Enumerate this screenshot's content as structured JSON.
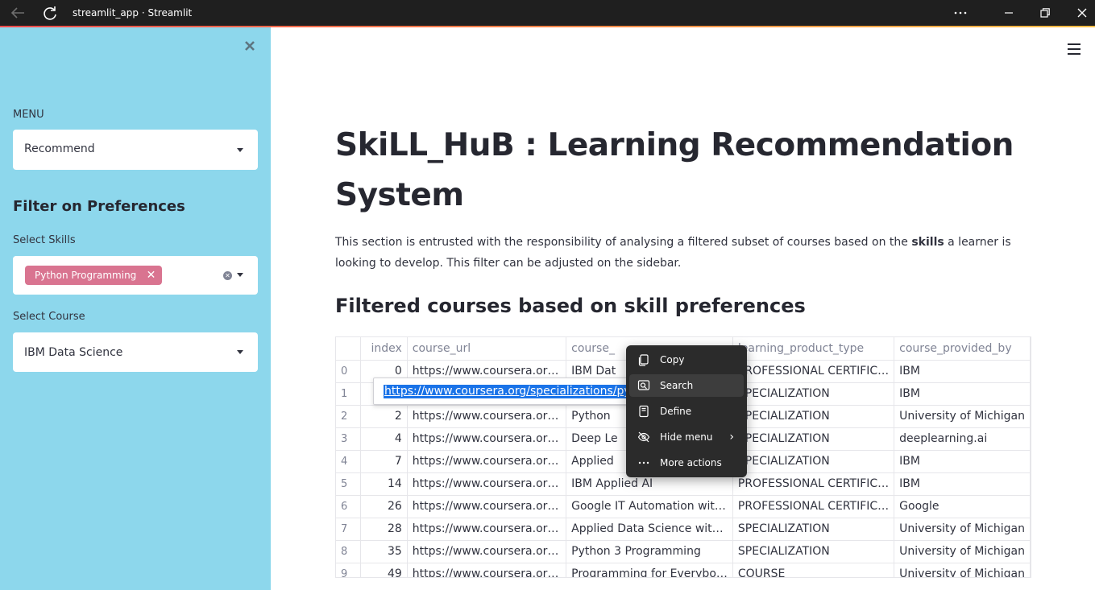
{
  "window": {
    "title": "streamlit_app · Streamlit"
  },
  "sidebar": {
    "menu_label": "MENU",
    "menu_value": "Recommend",
    "filter_heading": "Filter on Preferences",
    "skills_label": "Select Skills",
    "skills_chip": "Python Programming",
    "course_label": "Select Course",
    "course_value": "IBM Data Science",
    "bg_color": "#8dd7ec"
  },
  "main": {
    "title": "SkiLL_HuB : Learning Recommendation System",
    "para_before": "This section is entrusted with the responsibility of analysing a filtered subset of courses based on the ",
    "para_bold": "skills",
    "para_after": " a learner is looking to develop. This filter can be adjusted on the sidebar.",
    "subheading": "Filtered courses based on skill preferences"
  },
  "table": {
    "columns": [
      "",
      "index",
      "course_url",
      "course_",
      "learning_product_type",
      "course_provided_by"
    ],
    "rows": [
      [
        "0",
        "0",
        "https://www.coursera.or…",
        "IBM Dat",
        "PROFESSIONAL CERTIFIC…",
        "IBM"
      ],
      [
        "1",
        "",
        "",
        "",
        "SPECIALIZATION",
        "IBM"
      ],
      [
        "2",
        "2",
        "https://www.coursera.or…",
        "Python",
        "SPECIALIZATION",
        "University of Michigan"
      ],
      [
        "3",
        "4",
        "https://www.coursera.or…",
        "Deep Le",
        "SPECIALIZATION",
        "deeplearning.ai"
      ],
      [
        "4",
        "7",
        "https://www.coursera.or…",
        "Applied",
        "SPECIALIZATION",
        "IBM"
      ],
      [
        "5",
        "14",
        "https://www.coursera.or…",
        "IBM Applied AI",
        "PROFESSIONAL CERTIFIC…",
        "IBM"
      ],
      [
        "6",
        "26",
        "https://www.coursera.or…",
        "Google IT Automation wit…",
        "PROFESSIONAL CERTIFIC…",
        "Google"
      ],
      [
        "7",
        "28",
        "https://www.coursera.or…",
        "Applied Data Science wit…",
        "SPECIALIZATION",
        "University of Michigan"
      ],
      [
        "8",
        "35",
        "https://www.coursera.or…",
        "Python 3 Programming",
        "SPECIALIZATION",
        "University of Michigan"
      ],
      [
        "9",
        "49",
        "https://www.coursera.or…",
        "Programming for Everybo…",
        "COURSE",
        "University of Michigan"
      ]
    ]
  },
  "url_editor": {
    "value": "https://www.coursera.org/specializations/python"
  },
  "context_menu": {
    "items": [
      {
        "label": "Copy",
        "icon": "copy-icon"
      },
      {
        "label": "Search",
        "icon": "search-icon"
      },
      {
        "label": "Define",
        "icon": "book-icon"
      },
      {
        "label": "Hide menu",
        "icon": "eye-off-icon"
      },
      {
        "label": "More actions",
        "icon": "more-icon"
      }
    ]
  }
}
